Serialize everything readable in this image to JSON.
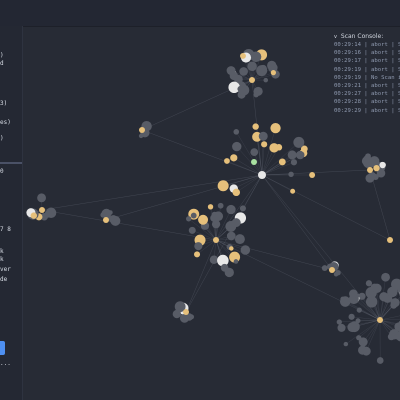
{
  "sidebar": {
    "fragments": [
      ")",
      "d",
      "3)",
      "es)",
      ")",
      "0",
      "7 8",
      "k",
      "k",
      "ver",
      "de",
      "..."
    ]
  },
  "console": {
    "title": "Scan Console:",
    "lines": [
      "00:29:14 | abort | Scan",
      "00:29:16 | abort | Scan",
      "00:29:17 | abort | Scan",
      "00:29:19 | abort | Scan",
      "00:29:19 | No Scan in P",
      "00:29:21 | abort | Scan",
      "00:29:27 | abort | Scan",
      "00:29:28 | abort | Scan",
      "00:29:29 | abort | Scan"
    ]
  },
  "graph": {
    "colors": {
      "background": "#272b35",
      "node": "#585c66",
      "highlight": "#e6c07b",
      "white": "#e8e8e8",
      "edge": "#8a90a0",
      "green": "#a8e0a0"
    }
  }
}
